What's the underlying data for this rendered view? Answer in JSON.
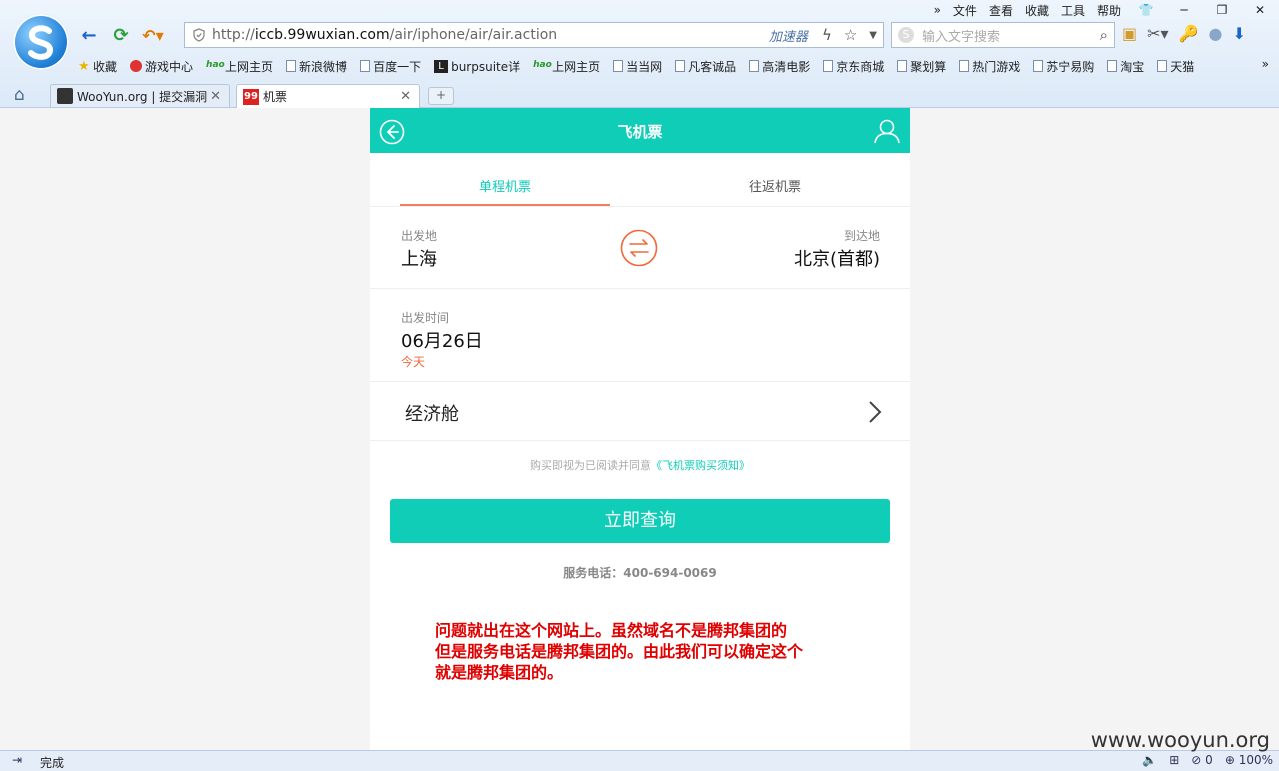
{
  "browser": {
    "menu": [
      "文件",
      "查看",
      "收藏",
      "工具",
      "帮助"
    ],
    "address": {
      "prefix": "http://",
      "host": "iccb.99wuxian.com",
      "path": "/air/iphone/air/air.action",
      "accelerator": "加速器"
    },
    "search": {
      "placeholder": "输入文字搜索"
    },
    "bookmarks": [
      {
        "label": "收藏",
        "icon": "star-icon"
      },
      {
        "label": "游戏中心",
        "icon": "game-icon"
      },
      {
        "label": "上网主页",
        "icon": "hao-icon"
      },
      {
        "label": "新浪微博",
        "icon": "page-icon"
      },
      {
        "label": "百度一下",
        "icon": "page-icon"
      },
      {
        "label": "burpsuite详",
        "icon": "l-icon"
      },
      {
        "label": "上网主页",
        "icon": "hao-icon"
      },
      {
        "label": "当当网",
        "icon": "page-icon"
      },
      {
        "label": "凡客诚品",
        "icon": "page-icon"
      },
      {
        "label": "高清电影",
        "icon": "page-icon"
      },
      {
        "label": "京东商城",
        "icon": "page-icon"
      },
      {
        "label": "聚划算",
        "icon": "page-icon"
      },
      {
        "label": "热门游戏",
        "icon": "page-icon"
      },
      {
        "label": "苏宁易购",
        "icon": "page-icon"
      },
      {
        "label": "淘宝",
        "icon": "page-icon"
      },
      {
        "label": "天猫",
        "icon": "page-icon"
      }
    ],
    "tabs": [
      {
        "label": "WooYun.org | 提交漏洞",
        "active": false
      },
      {
        "label": "机票",
        "active": true,
        "favicon": "99"
      }
    ],
    "status": {
      "text": "完成",
      "blocked": "0",
      "zoom": "100%"
    }
  },
  "page": {
    "header_title": "飞机票",
    "segments": [
      "单程机票",
      "往返机票"
    ],
    "route": {
      "from_label": "出发地",
      "from_value": "上海",
      "to_label": "到达地",
      "to_value": "北京(首都)"
    },
    "date": {
      "label": "出发时间",
      "value": "06月26日",
      "today": "今天"
    },
    "cabin": "经济舱",
    "agreement": {
      "text": "购买即视为已阅读并同意",
      "link": "《飞机票购买须知》"
    },
    "query_button": "立即查询",
    "service_phone": "服务电话：400-694-0069",
    "accent_color": "#0fcdb7"
  },
  "annotation": {
    "line1": "问题就出在这个网站上。虽然域名不是腾邦集团的",
    "line2": "但是服务电话是腾邦集团的。由此我们可以确定这个",
    "line3": "就是腾邦集团的。"
  },
  "watermark": "www.wooyun.org"
}
